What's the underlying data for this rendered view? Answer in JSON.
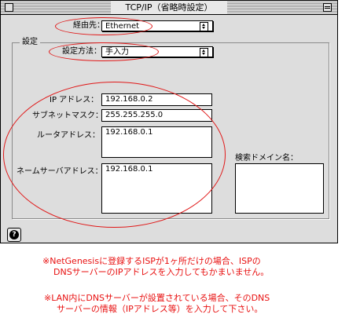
{
  "window": {
    "title": "TCP/IP（省略時設定）"
  },
  "connect_via": {
    "label": "経由先：",
    "value": "Ethernet"
  },
  "setup": {
    "group_label": "設定",
    "configure_label": "設定方法：",
    "configure_value": "手入力",
    "ip_label": "IP アドレス：",
    "ip_value": "192.168.0.2",
    "subnet_label": "サブネットマスク：",
    "subnet_value": "255.255.255.0",
    "router_label": "ルータアドレス：",
    "router_value": "192.168.0.1",
    "dns_label": "ネームサーバアドレス：",
    "dns_value": "192.168.0.1",
    "search_domain_label": "検索ドメイン名："
  },
  "help": {
    "icon": "question-mark",
    "glyph": "?"
  },
  "notes": {
    "note1_line1": "※NetGenesisに登録するISPが1ヶ所だけの場合、ISPの",
    "note1_line2": "DNSサーバーのIPアドレスを入力してもかまいません。",
    "note2_line1": "※LAN内にDNSサーバーが設置されている場合、そのDNS",
    "note2_line2": "サーバーの情報（IPアドレス等）を入力して下さい。"
  },
  "colors": {
    "annotation": "#e01818",
    "window_bg": "#dddddd"
  }
}
